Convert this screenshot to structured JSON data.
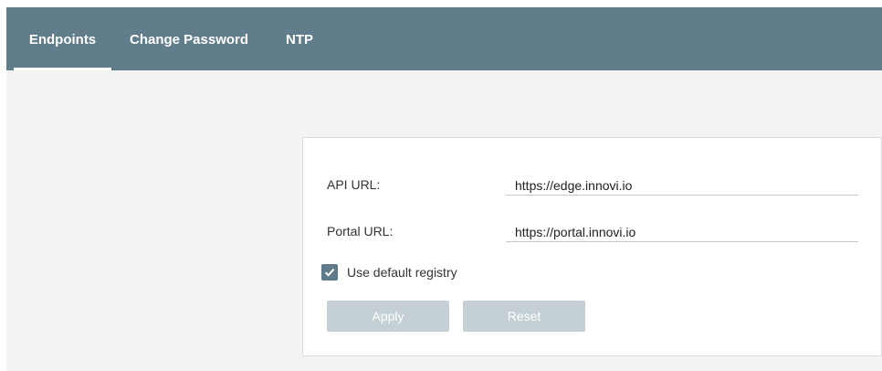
{
  "tabs": [
    {
      "label": "Endpoints",
      "active": true
    },
    {
      "label": "Change Password",
      "active": false
    },
    {
      "label": "NTP",
      "active": false
    }
  ],
  "form": {
    "api_url": {
      "label": "API URL:",
      "value": "https://edge.innovi.io"
    },
    "portal_url": {
      "label": "Portal URL:",
      "value": "https://portal.innovi.io"
    },
    "default_registry": {
      "label": "Use default registry",
      "checked": true
    }
  },
  "buttons": {
    "apply_label": "Apply",
    "reset_label": "Reset"
  },
  "colors": {
    "tabbar": "#617d8b",
    "checkbox": "#5f7b89",
    "button_disabled": "#c5d0d5",
    "background": "#f3f3f3"
  }
}
